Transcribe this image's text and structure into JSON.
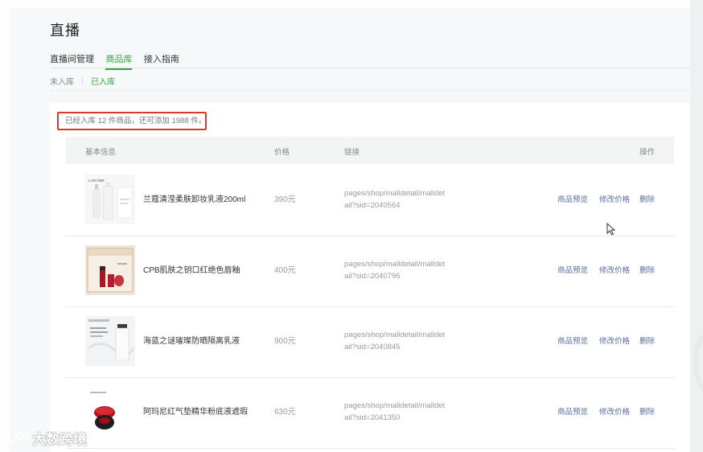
{
  "page_title": "直播",
  "tabs": [
    {
      "label": "直播间管理",
      "active": false
    },
    {
      "label": "商品库",
      "active": true
    },
    {
      "label": "接入指南",
      "active": false
    }
  ],
  "subtabs": [
    {
      "label": "未入库",
      "active": false
    },
    {
      "label": "已入库",
      "active": true
    }
  ],
  "notice": "已经入库 12 件商品，还可添加 1988 件。",
  "table": {
    "headers": {
      "info": "基本信息",
      "price": "价格",
      "link": "链接",
      "actions": "操作"
    },
    "rows": [
      {
        "name": "兰蔻清滢柔肤卸妆乳液200ml",
        "price": "390元",
        "link1": "pages/shop/malldetail/malldet",
        "link2": "ail?sid=2040564",
        "preview": "商品预览",
        "edit_price": "修改价格",
        "delete": "删除",
        "thumb_brand": "LANCÔME"
      },
      {
        "name": "CPB肌肤之钥口红绝色唇釉",
        "price": "400元",
        "link1": "pages/shop/malldetail/malldet",
        "link2": "ail?sid=2040796",
        "preview": "商品预览",
        "edit_price": "修改价格",
        "delete": "删除",
        "thumb_brand": ""
      },
      {
        "name": "海蓝之谜璀璨防晒隔离乳液",
        "price": "900元",
        "link1": "pages/shop/malldetail/malldet",
        "link2": "ail?sid=2040845",
        "preview": "商品预览",
        "edit_price": "修改价格",
        "delete": "删除",
        "thumb_brand": ""
      },
      {
        "name": "阿玛尼红气垫精华粉底液遮瑕",
        "price": "630元",
        "link1": "pages/shop/malldetail/malldet",
        "link2": "ail?sid=2041350",
        "preview": "商品预览",
        "edit_price": "修改价格",
        "delete": "删除",
        "thumb_brand": ""
      }
    ]
  },
  "watermark": "大数跨境",
  "colors": {
    "accent": "#2bab33",
    "link": "#5a6f9e",
    "highlight_border": "#d83a2c"
  }
}
